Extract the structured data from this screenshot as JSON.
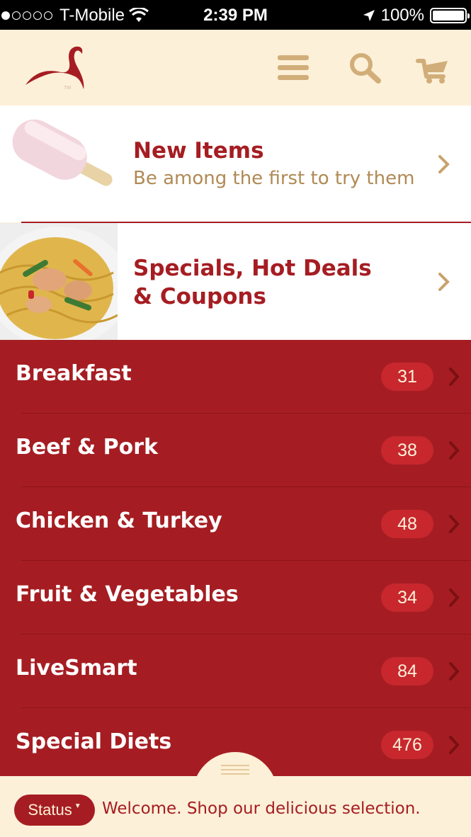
{
  "status_bar": {
    "carrier": "T-Mobile",
    "time": "2:39 PM",
    "battery": "100%"
  },
  "header": {
    "logo_mark": "TM",
    "icons": [
      "menu-icon",
      "search-icon",
      "cart-icon"
    ]
  },
  "promos": [
    {
      "title": "New Items",
      "subtitle": "Be among the first to try them"
    },
    {
      "title_line1": "Specials, Hot Deals",
      "title_line2": "& Coupons"
    }
  ],
  "categories": [
    {
      "label": "Breakfast",
      "count": "31"
    },
    {
      "label": "Beef & Pork",
      "count": "38"
    },
    {
      "label": "Chicken & Turkey",
      "count": "48"
    },
    {
      "label": "Fruit & Vegetables",
      "count": "34"
    },
    {
      "label": "LiveSmart",
      "count": "84"
    },
    {
      "label": "Special Diets",
      "count": "476"
    }
  ],
  "bottom_bar": {
    "status_label": "Status",
    "welcome": "Welcome. Shop our delicious selection."
  },
  "colors": {
    "brand_red": "#a51d22",
    "cream": "#fdf0d8",
    "gold": "#b08a55"
  }
}
